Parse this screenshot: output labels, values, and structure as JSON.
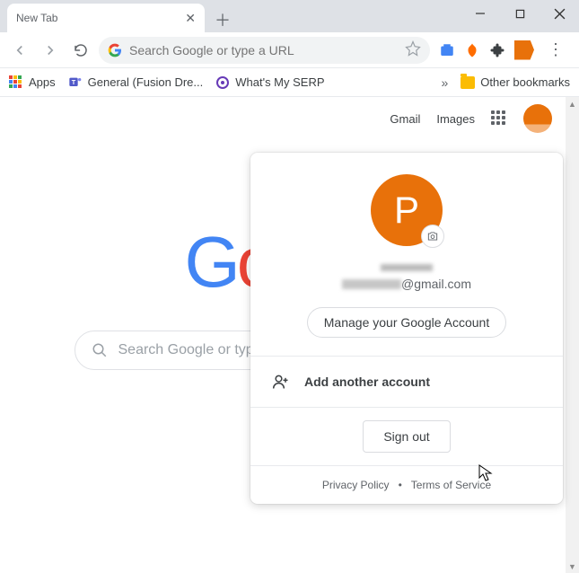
{
  "window": {
    "tab_title": "New Tab"
  },
  "toolbar": {
    "omnibox_placeholder": "Search Google or type a URL"
  },
  "bookmarks": {
    "apps": "Apps",
    "item1": "General (Fusion Dre...",
    "item2": "What's My SERP",
    "other": "Other bookmarks"
  },
  "ntp": {
    "gmail": "Gmail",
    "images": "Images",
    "search_placeholder": "Search Google or type a URL"
  },
  "account": {
    "avatar_initial": "P",
    "email_suffix": "@gmail.com",
    "manage_label": "Manage your Google Account",
    "add_account_label": "Add another account",
    "sign_out_label": "Sign out",
    "privacy_label": "Privacy Policy",
    "tos_label": "Terms of Service",
    "separator": "•"
  }
}
